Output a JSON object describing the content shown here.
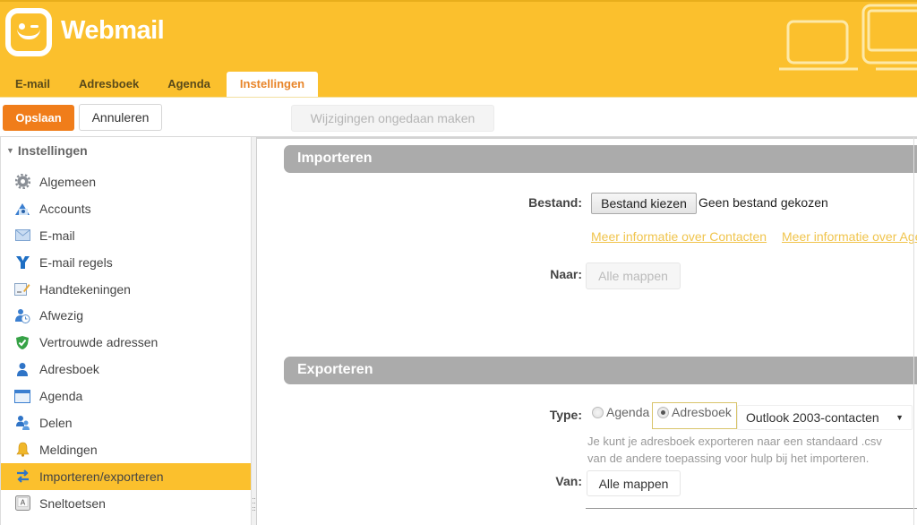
{
  "app": {
    "brand": "Webmail",
    "accent_color": "#fbc02d",
    "primary_button_color": "#f07d1a"
  },
  "tabs": [
    {
      "label": "E-mail",
      "active": false
    },
    {
      "label": "Adresboek",
      "active": false
    },
    {
      "label": "Agenda",
      "active": false
    },
    {
      "label": "Instellingen",
      "active": true
    }
  ],
  "toolbar": {
    "save_label": "Opslaan",
    "cancel_label": "Annuleren",
    "undo_label": "Wijzigingen ongedaan maken"
  },
  "sidebar": {
    "heading": "Instellingen",
    "items": [
      {
        "label": "Algemeen",
        "icon": "gear-icon"
      },
      {
        "label": "Accounts",
        "icon": "accounts-icon"
      },
      {
        "label": "E-mail",
        "icon": "envelope-icon"
      },
      {
        "label": "E-mail regels",
        "icon": "rules-icon"
      },
      {
        "label": "Handtekeningen",
        "icon": "signature-icon"
      },
      {
        "label": "Afwezig",
        "icon": "away-icon"
      },
      {
        "label": "Vertrouwde adressen",
        "icon": "shield-check-icon"
      },
      {
        "label": "Adresboek",
        "icon": "person-icon"
      },
      {
        "label": "Agenda",
        "icon": "calendar-icon"
      },
      {
        "label": "Delen",
        "icon": "share-icon"
      },
      {
        "label": "Meldingen",
        "icon": "bell-icon"
      },
      {
        "label": "Importeren/exporteren",
        "icon": "import-export-icon",
        "active": true
      },
      {
        "label": "Sneltoetsen",
        "icon": "keyboard-icon"
      }
    ]
  },
  "import": {
    "title": "Importeren",
    "file_label": "Bestand:",
    "file_button": "Bestand kiezen",
    "file_status": "Geen bestand gekozen",
    "link_contacts": "Meer informatie over Contacten",
    "link_agenda": "Meer informatie over Agenda",
    "to_label": "Naar:",
    "to_value": "Alle mappen"
  },
  "export": {
    "title": "Exporteren",
    "type_label": "Type:",
    "type_options": [
      {
        "label": "Agenda",
        "checked": false
      },
      {
        "label": "Adresboek",
        "checked": true
      }
    ],
    "format_selected": "Outlook 2003-contacten",
    "hint_line1": "Je kunt je adresboek exporteren naar een standaard .csv",
    "hint_line2": "van de andere toepassing voor hulp bij het importeren.",
    "from_label": "Van:",
    "from_value": "Alle mappen"
  }
}
